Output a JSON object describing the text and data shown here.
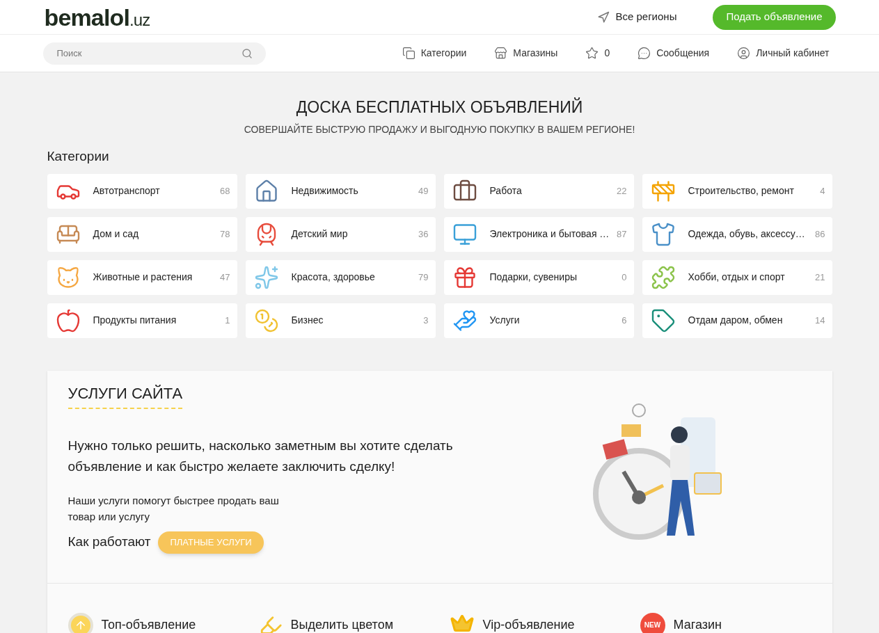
{
  "header": {
    "logo": "bemalol",
    "logo_suffix": ".uz",
    "region": "Все регионы",
    "post_button": "Подать объявление"
  },
  "nav": {
    "search": {
      "placeholder": "Поиск"
    },
    "links": [
      {
        "kind": "categories",
        "label": "Категории"
      },
      {
        "kind": "shops",
        "label": "Магазины"
      },
      {
        "kind": "favorites",
        "label": "0"
      },
      {
        "kind": "messages",
        "label": "Сообщения"
      },
      {
        "kind": "account",
        "label": "Личный кабинет"
      }
    ]
  },
  "hero": {
    "title": "ДОСКА БЕСПЛАТНЫХ ОБЪЯВЛЕНИЙ",
    "subtitle": "СОВЕРШАЙТЕ БЫСТРУЮ ПРОДАЖУ И ВЫГОДНУЮ ПОКУПКУ В ВАШЕМ РЕГИОНЕ!"
  },
  "categories": {
    "heading": "Категории",
    "items": [
      {
        "name": "Автотранспорт",
        "count": "68"
      },
      {
        "name": "Недвижимость",
        "count": "49"
      },
      {
        "name": "Работа",
        "count": "22"
      },
      {
        "name": "Строительство, ремонт",
        "count": "4"
      },
      {
        "name": "Дом и сад",
        "count": "78"
      },
      {
        "name": "Детский мир",
        "count": "36"
      },
      {
        "name": "Электроника и бытовая …",
        "count": "87"
      },
      {
        "name": "Одежда, обувь, аксессу…",
        "count": "86"
      },
      {
        "name": "Животные и растения",
        "count": "47"
      },
      {
        "name": "Красота, здоровье",
        "count": "79"
      },
      {
        "name": "Подарки, сувениры",
        "count": "0"
      },
      {
        "name": "Хобби, отдых и спорт",
        "count": "21"
      },
      {
        "name": "Продукты питания",
        "count": "1"
      },
      {
        "name": "Бизнес",
        "count": "3"
      },
      {
        "name": "Услуги",
        "count": "6"
      },
      {
        "name": "Отдам даром, обмен",
        "count": "14"
      }
    ]
  },
  "services": {
    "heading": "УСЛУГИ САЙТА",
    "lead": "Нужно только решить, насколько заметным вы хотите сделать объявление и как быстро желаете заключить сделку!",
    "text": "Наши услуги помогут быстрее продать ваш товар или услугу",
    "how_label": "Как работают",
    "how_button": "ПЛАТНЫЕ УСЛУГИ",
    "items": [
      {
        "kind": "top",
        "label": "Топ-объявление"
      },
      {
        "kind": "highlight",
        "label": "Выделить цветом"
      },
      {
        "kind": "vip",
        "label": "Vip-объявление"
      },
      {
        "kind": "shop",
        "label": "Магазин",
        "badge": "NEW"
      }
    ]
  }
}
